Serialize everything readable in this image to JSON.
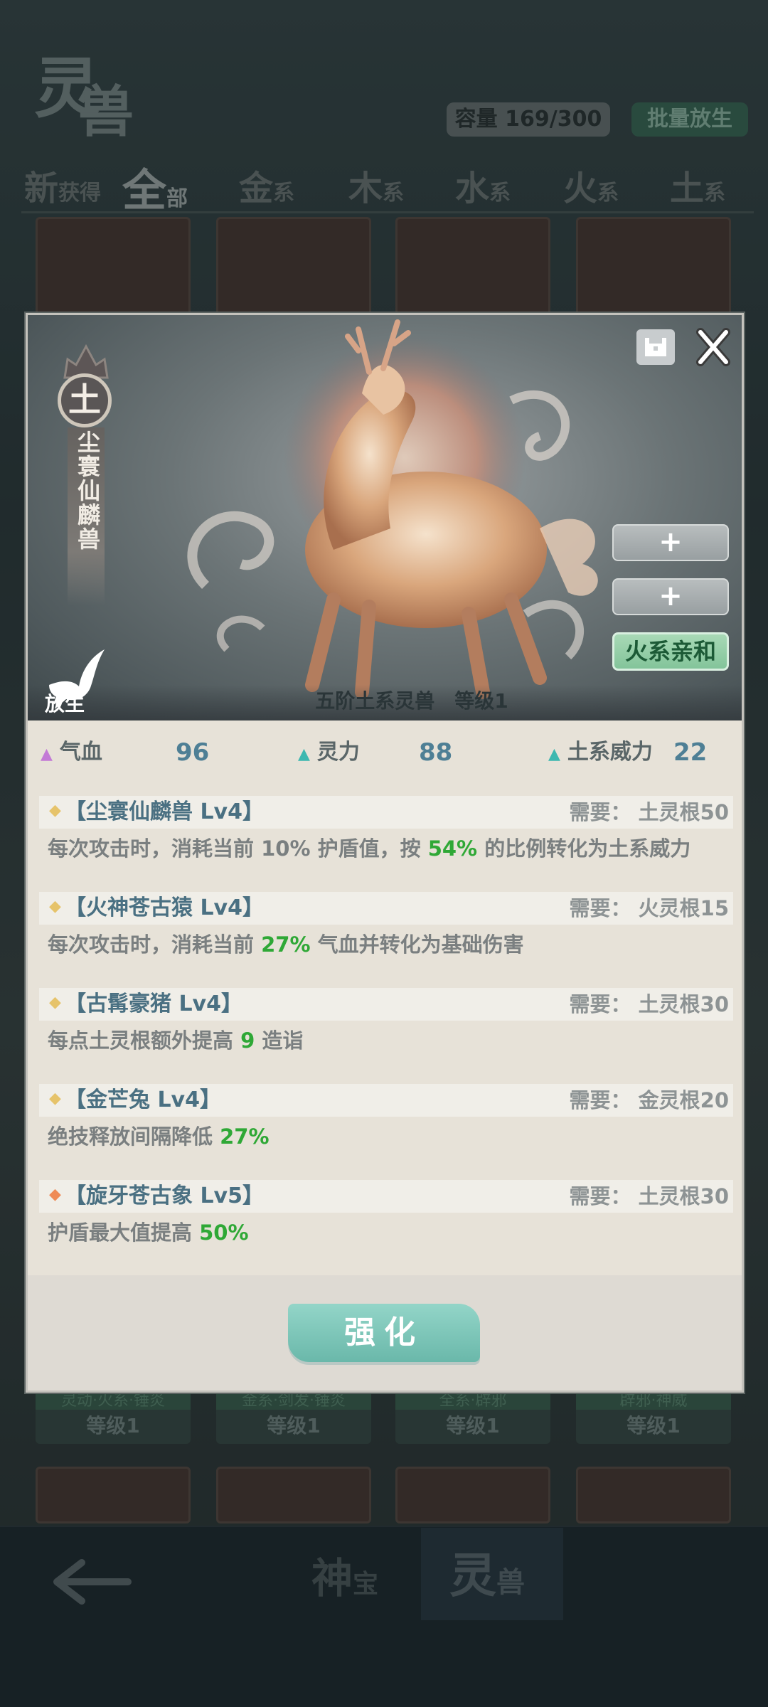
{
  "background": {
    "logo_chars": [
      "灵",
      "兽"
    ],
    "capacity": "容量 169/300",
    "batch_release": "批量放生",
    "filter_tabs": [
      {
        "big": "新",
        "small": "获得"
      },
      {
        "big": "全",
        "small": "部"
      },
      {
        "big": "金",
        "small": "系"
      },
      {
        "big": "木",
        "small": "系"
      },
      {
        "big": "水",
        "small": "系"
      },
      {
        "big": "火",
        "small": "系"
      },
      {
        "big": "土",
        "small": "系"
      }
    ],
    "card_tags": [
      "灵动·火系·锤炎",
      "金系·剑发·锤炎",
      "全系·辟邪",
      "辟邪·神威"
    ],
    "card_levels": [
      "等级1",
      "等级1",
      "等级1",
      "等级1"
    ],
    "nav": [
      {
        "big": "神",
        "small": "宝"
      },
      {
        "big": "灵",
        "small": "兽"
      }
    ]
  },
  "modal": {
    "element_badge": "土",
    "beast_name": "尘寰仙麟兽",
    "release_label": "放生",
    "side_buttons": [
      "+",
      "+"
    ],
    "affinity": "火系亲和",
    "level_line": "五阶土系灵兽　等级1",
    "stats": [
      {
        "label": "气血",
        "value": "96",
        "color": "#c37ad6"
      },
      {
        "label": "灵力",
        "value": "88",
        "color": "#3cb8b0"
      },
      {
        "label": "土系威力",
        "value": "22",
        "color": "#3cb8b0"
      }
    ],
    "skills": [
      {
        "title": "【尘寰仙麟兽 Lv4】",
        "requirement": "需要：  土灵根50",
        "diamond_color": "#e6c36a",
        "desc_parts": [
          "每次攻击时，消耗当前 10% 护盾值，按 ",
          "54%",
          " 的比例转化为土系威力"
        ]
      },
      {
        "title": "【火神苍古猿 Lv4】",
        "requirement": "需要：  火灵根15",
        "diamond_color": "#e6c36a",
        "desc_parts": [
          "每次攻击时，消耗当前 ",
          "27%",
          " 气血并转化为基础伤害"
        ]
      },
      {
        "title": "【古髯豪猪 Lv4】",
        "requirement": "需要：  土灵根30",
        "diamond_color": "#e6c36a",
        "desc_parts": [
          "每点土灵根额外提高 ",
          "9",
          " 造诣"
        ]
      },
      {
        "title": "【金芒兔 Lv4】",
        "requirement": "需要：  金灵根20",
        "diamond_color": "#e6c36a",
        "desc_parts": [
          "绝技释放间隔降低 ",
          "27%",
          ""
        ]
      },
      {
        "title": "【旋牙苍古象 Lv5】",
        "requirement": "需要：  土灵根30",
        "diamond_color": "#ef8a55",
        "desc_parts": [
          "护盾最大值提高 ",
          "50%",
          ""
        ]
      }
    ],
    "enhance_label": "强化"
  }
}
